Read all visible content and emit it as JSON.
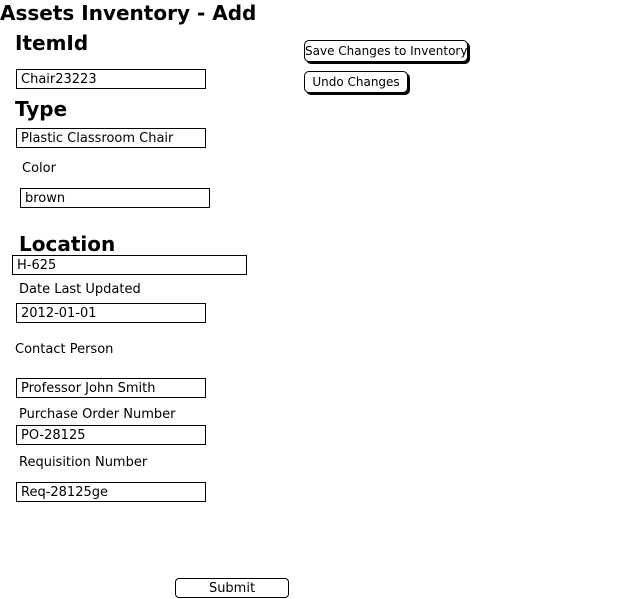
{
  "page": {
    "title": "Assets Inventory - Add"
  },
  "toolbar": {
    "save_label": "Save Changes to Inventory",
    "undo_label": "Undo Changes"
  },
  "form": {
    "item_id": {
      "heading": "ItemId",
      "value": "Chair23223"
    },
    "type": {
      "heading": "Type",
      "value": "Plastic Classroom Chair"
    },
    "color": {
      "label": "Color",
      "value": "brown"
    },
    "location": {
      "heading": "Location",
      "value": "H-625"
    },
    "date_last_updated": {
      "label": "Date Last Updated",
      "value": "2012-01-01"
    },
    "contact_person": {
      "label": "Contact Person",
      "value": "Professor John Smith"
    },
    "purchase_order_number": {
      "label": "Purchase Order Number",
      "value": "PO-28125"
    },
    "requisition_number": {
      "label": "Requisition Number",
      "value": "Req-28125ge"
    },
    "submit_label": "Submit"
  }
}
